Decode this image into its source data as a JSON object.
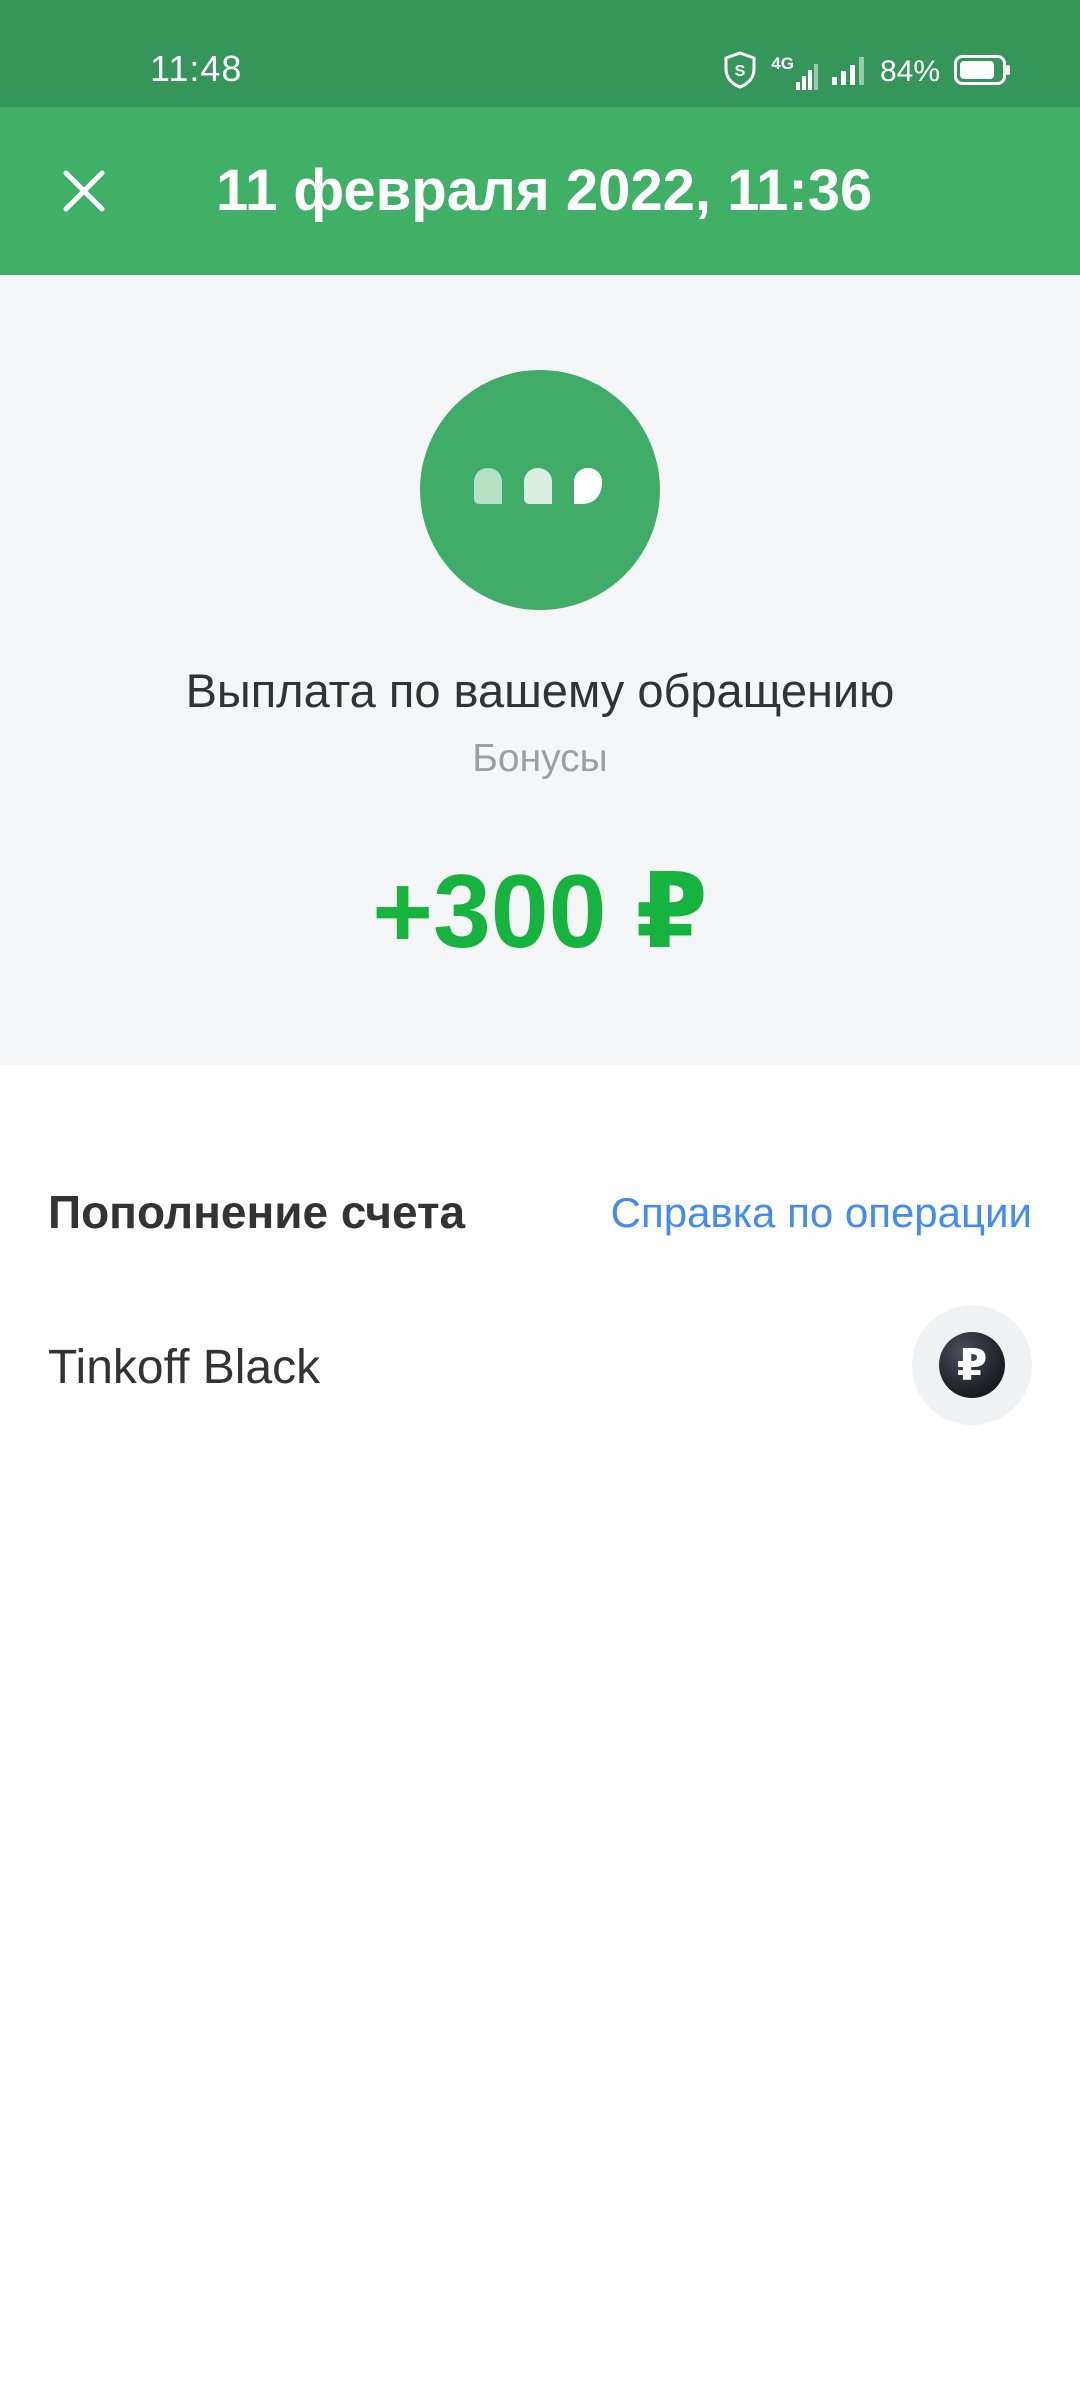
{
  "status_bar": {
    "time": "11:48",
    "network": "4G",
    "battery_percent": "84%",
    "battery_level": 0.84,
    "icons": [
      "shield-icon",
      "network-4g-icon",
      "signal-icon",
      "battery-icon"
    ]
  },
  "app_bar": {
    "title": "11 февраля 2022, 11:36",
    "close_icon": "close-icon",
    "color": "#3fb065"
  },
  "operation": {
    "icon": "chat-bubbles-icon",
    "title": "Выплата по вашему обращению",
    "category": "Бонусы",
    "amount": "+300 ₽",
    "amount_color": "#16b43e"
  },
  "details": {
    "section_title": "Пополнение счета",
    "help_link": "Справка по операции",
    "link_color": "#428bf9",
    "account": {
      "name": "Tinkoff Black",
      "currency_symbol": "₽",
      "icon": "ruble-account-icon"
    }
  }
}
